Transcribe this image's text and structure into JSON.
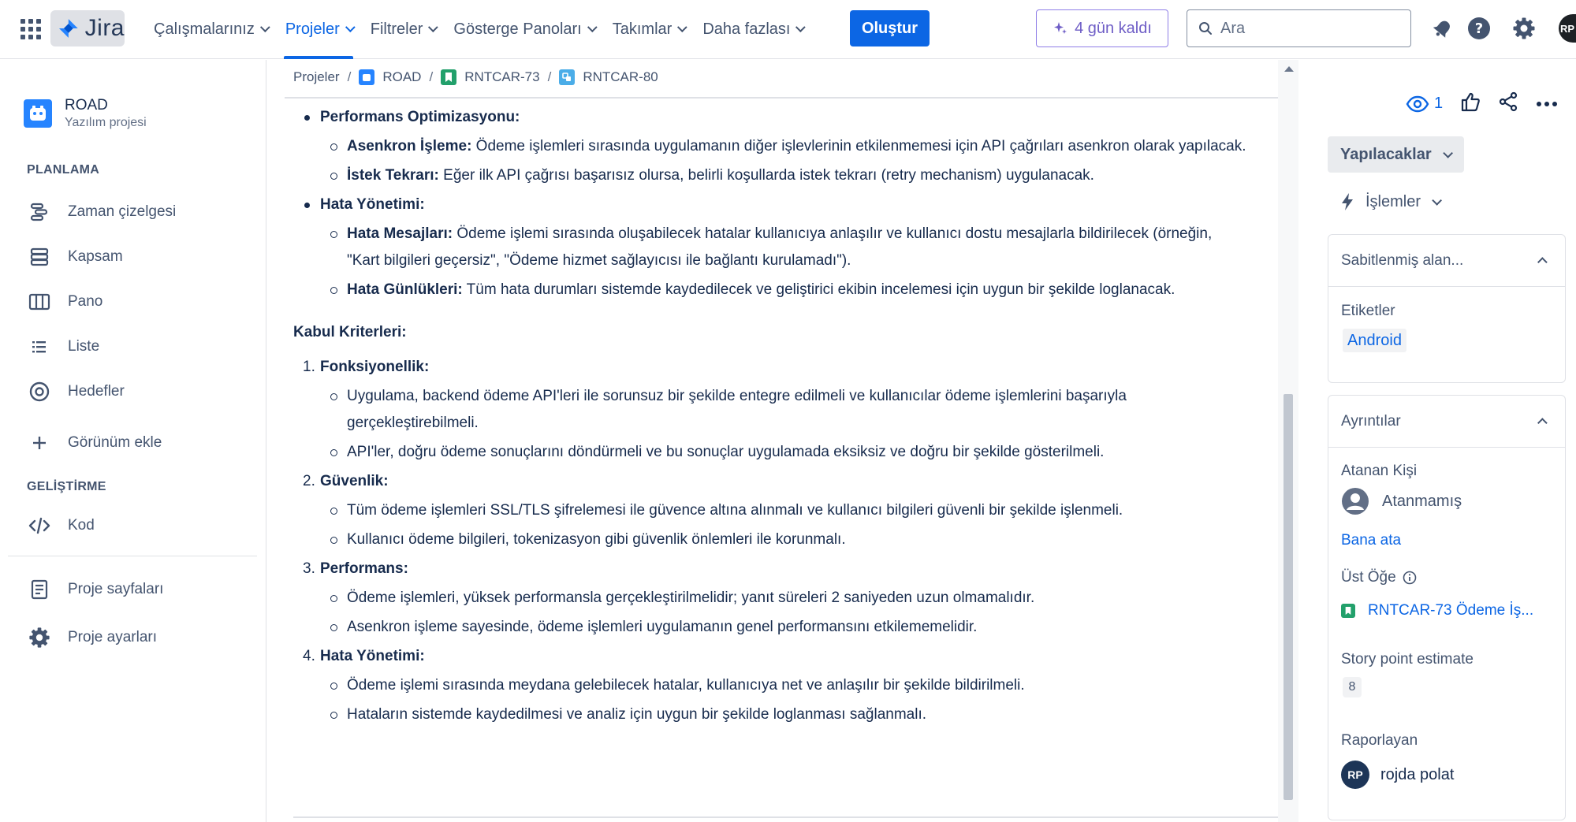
{
  "topnav": {
    "logo": "Jira",
    "items": [
      {
        "label": "Çalışmalarınız",
        "active": false
      },
      {
        "label": "Projeler",
        "active": true
      },
      {
        "label": "Filtreler",
        "active": false
      },
      {
        "label": "Gösterge Panoları",
        "active": false
      },
      {
        "label": "Takımlar",
        "active": false
      },
      {
        "label": "Daha fazlası",
        "active": false
      }
    ],
    "create_label": "Oluştur",
    "trial_label": "4 gün kaldı",
    "search_placeholder": "Ara",
    "user_initials": "RP",
    "icons": [
      "app-switcher-icon",
      "notifications-icon",
      "help-icon",
      "settings-icon"
    ]
  },
  "sidebar": {
    "project_name": "ROAD",
    "project_type": "Yazılım projesi",
    "sections": {
      "planning": "PLANLAMA",
      "development": "GELİŞTİRME"
    },
    "planning_items": [
      {
        "label": "Zaman çizelgesi",
        "icon": "timeline-icon"
      },
      {
        "label": "Kapsam",
        "icon": "backlog-icon"
      },
      {
        "label": "Pano",
        "icon": "board-icon"
      },
      {
        "label": "Liste",
        "icon": "list-icon"
      },
      {
        "label": "Hedefler",
        "icon": "goals-icon"
      },
      {
        "label": "Görünüm ekle",
        "icon": "plus-icon"
      }
    ],
    "dev_items": [
      {
        "label": "Kod",
        "icon": "code-icon"
      }
    ],
    "footer_items": [
      {
        "label": "Proje sayfaları",
        "icon": "pages-icon"
      },
      {
        "label": "Proje ayarları",
        "icon": "gear-icon"
      }
    ]
  },
  "breadcrumb": {
    "root": "Projeler",
    "project": "ROAD",
    "parent": "RNTCAR-73",
    "current": "RNTCAR-80"
  },
  "content": {
    "perf_title": "Performans Optimizasyonu:",
    "perf_items": [
      {
        "bold": "Asenkron İşleme:",
        "text": " Ödeme işlemleri sırasında uygulamanın diğer işlevlerinin etkilenmemesi için API çağrıları asenkron olarak yapılacak."
      },
      {
        "bold": "İstek Tekrarı:",
        "text": " Eğer ilk API çağrısı başarısız olursa, belirli koşullarda istek tekrarı (retry mechanism) uygulanacak."
      }
    ],
    "error_title": "Hata Yönetimi:",
    "error_items": [
      {
        "bold": "Hata Mesajları:",
        "text": " Ödeme işlemi sırasında oluşabilecek hatalar kullanıcıya anlaşılır ve kullanıcı dostu mesajlarla bildirilecek (örneğin, \"Kart bilgileri geçersiz\", \"Ödeme hizmet sağlayıcısı ile bağlantı kurulamadı\")."
      },
      {
        "bold": "Hata Günlükleri:",
        "text": " Tüm hata durumları sistemde kaydedilecek ve geliştirici ekibin incelemesi için uygun bir şekilde loglanacak."
      }
    ],
    "acceptance_title": "Kabul Kriterleri:",
    "criteria": [
      {
        "num": "1.",
        "title": "Fonksiyonellik:",
        "items": [
          "Uygulama, backend ödeme API'leri ile sorunsuz bir şekilde entegre edilmeli ve kullanıcılar ödeme işlemlerini başarıyla gerçekleştirebilmeli.",
          "API'ler, doğru ödeme sonuçlarını döndürmeli ve bu sonuçlar uygulamada eksiksiz ve doğru bir şekilde gösterilmeli."
        ]
      },
      {
        "num": "2.",
        "title": "Güvenlik:",
        "items": [
          "Tüm ödeme işlemleri SSL/TLS şifrelemesi ile güvence altına alınmalı ve kullanıcı bilgileri güvenli bir şekilde işlenmeli.",
          "Kullanıcı ödeme bilgileri, tokenizasyon gibi güvenlik önlemleri ile korunmalı."
        ]
      },
      {
        "num": "3.",
        "title": "Performans:",
        "items": [
          "Ödeme işlemleri, yüksek performansla gerçekleştirilmelidir; yanıt süreleri 2 saniyeden uzun olmamalıdır.",
          "Asenkron işleme sayesinde, ödeme işlemleri uygulamanın genel performansını etkilememelidir."
        ]
      },
      {
        "num": "4.",
        "title": "Hata Yönetimi:",
        "items": [
          "Ödeme işlemi sırasında meydana gelebilecek hatalar, kullanıcıya net ve anlaşılır bir şekilde bildirilmeli.",
          "Hataların sistemde kaydedilmesi ve analiz için uygun bir şekilde loglanması sağlanmalı."
        ]
      }
    ]
  },
  "right_panel": {
    "watchers": "1",
    "status": "Yapılacaklar",
    "actions": "İşlemler",
    "pinned_header": "Sabitlenmiş alan...",
    "labels_label": "Etiketler",
    "label_value": "Android",
    "details_header": "Ayrıntılar",
    "assignee_label": "Atanan Kişi",
    "assignee_value": "Atanmamış",
    "assign_me": "Bana ata",
    "parent_label": "Üst Öğe",
    "parent_value": "RNTCAR-73 Ödeme İş...",
    "story_points_label": "Story point estimate",
    "story_points_value": "8",
    "reporter_label": "Raporlayan",
    "reporter_initials": "RP",
    "reporter_name": "rojda polat"
  },
  "colors": {
    "accent": "#0c66e4",
    "trial": "#6e5dc6",
    "story_green": "#22a06b",
    "subtask_blue": "#4bade8"
  }
}
